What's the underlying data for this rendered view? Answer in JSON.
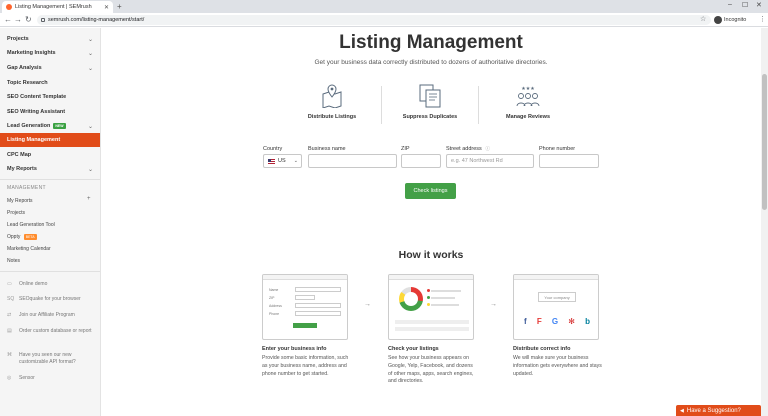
{
  "browser": {
    "tab_title": "Listing Management | SEMrush",
    "url": "semrush.com/listing-management/start/",
    "incognito_label": "Incognito"
  },
  "sidebar": {
    "main_items": [
      {
        "label": "Projects",
        "chevron": true
      },
      {
        "label": "Marketing Insights",
        "chevron": true
      },
      {
        "label": "Gap Analysis",
        "chevron": true
      },
      {
        "label": "Topic Research",
        "chevron": false
      },
      {
        "label": "SEO Content Template",
        "chevron": false
      },
      {
        "label": "SEO Writing Assistant",
        "chevron": false
      },
      {
        "label": "Lead Generation",
        "chevron": true,
        "badge": "NEW"
      },
      {
        "label": "Listing Management",
        "chevron": false,
        "active": true
      },
      {
        "label": "CPC Map",
        "chevron": false
      },
      {
        "label": "My Reports",
        "chevron": true
      }
    ],
    "management_heading": "MANAGEMENT",
    "management_items": [
      {
        "label": "My Reports",
        "plus": true
      },
      {
        "label": "Projects"
      },
      {
        "label": "Lead Generation Tool"
      },
      {
        "label": "Oppty",
        "badge": "BETA"
      },
      {
        "label": "Marketing Calendar"
      },
      {
        "label": "Notes"
      }
    ],
    "utility_items": [
      {
        "label": "Online demo"
      },
      {
        "label": "SEOquake for your browser"
      },
      {
        "label": "Join our Affiliate Program"
      },
      {
        "label": "Order custom database or report"
      },
      {
        "label": "Have you seen our new customizable API format?"
      },
      {
        "label": "Sensor"
      }
    ]
  },
  "main": {
    "title": "Listing Management",
    "subtitle": "Get your business data correctly distributed to dozens of authoritative directories.",
    "features": [
      {
        "label": "Distribute Listings",
        "icon": "map-pin-icon"
      },
      {
        "label": "Suppress Duplicates",
        "icon": "duplicate-docs-icon"
      },
      {
        "label": "Manage Reviews",
        "icon": "reviews-people-icon"
      }
    ],
    "form": {
      "country_label": "Country",
      "country_value": "US",
      "business_label": "Business name",
      "zip_label": "ZIP",
      "street_label": "Street address",
      "street_placeholder": "e.g. 47 Northwest Rd",
      "phone_label": "Phone number",
      "submit_label": "Check listings"
    },
    "how": {
      "title": "How it works",
      "card1_fields": [
        "Name",
        "ZIP",
        "Address",
        "Phone"
      ],
      "card3_placeholder": "Your company",
      "steps": [
        {
          "title": "Enter your business info",
          "desc": "Provide some basic information, such as your business name, address and phone number to get started."
        },
        {
          "title": "Check your listings",
          "desc": "See how your business appears on Google, Yelp, Facebook, and dozens of other maps, apps, search engines, and directories."
        },
        {
          "title": "Distribute correct info",
          "desc": "We will make sure your business information gets everywhere and stays updated."
        }
      ]
    }
  },
  "feedback": {
    "label": "Have a Suggestion?"
  },
  "colors": {
    "accent": "#e14c19",
    "cta": "#43a047"
  }
}
